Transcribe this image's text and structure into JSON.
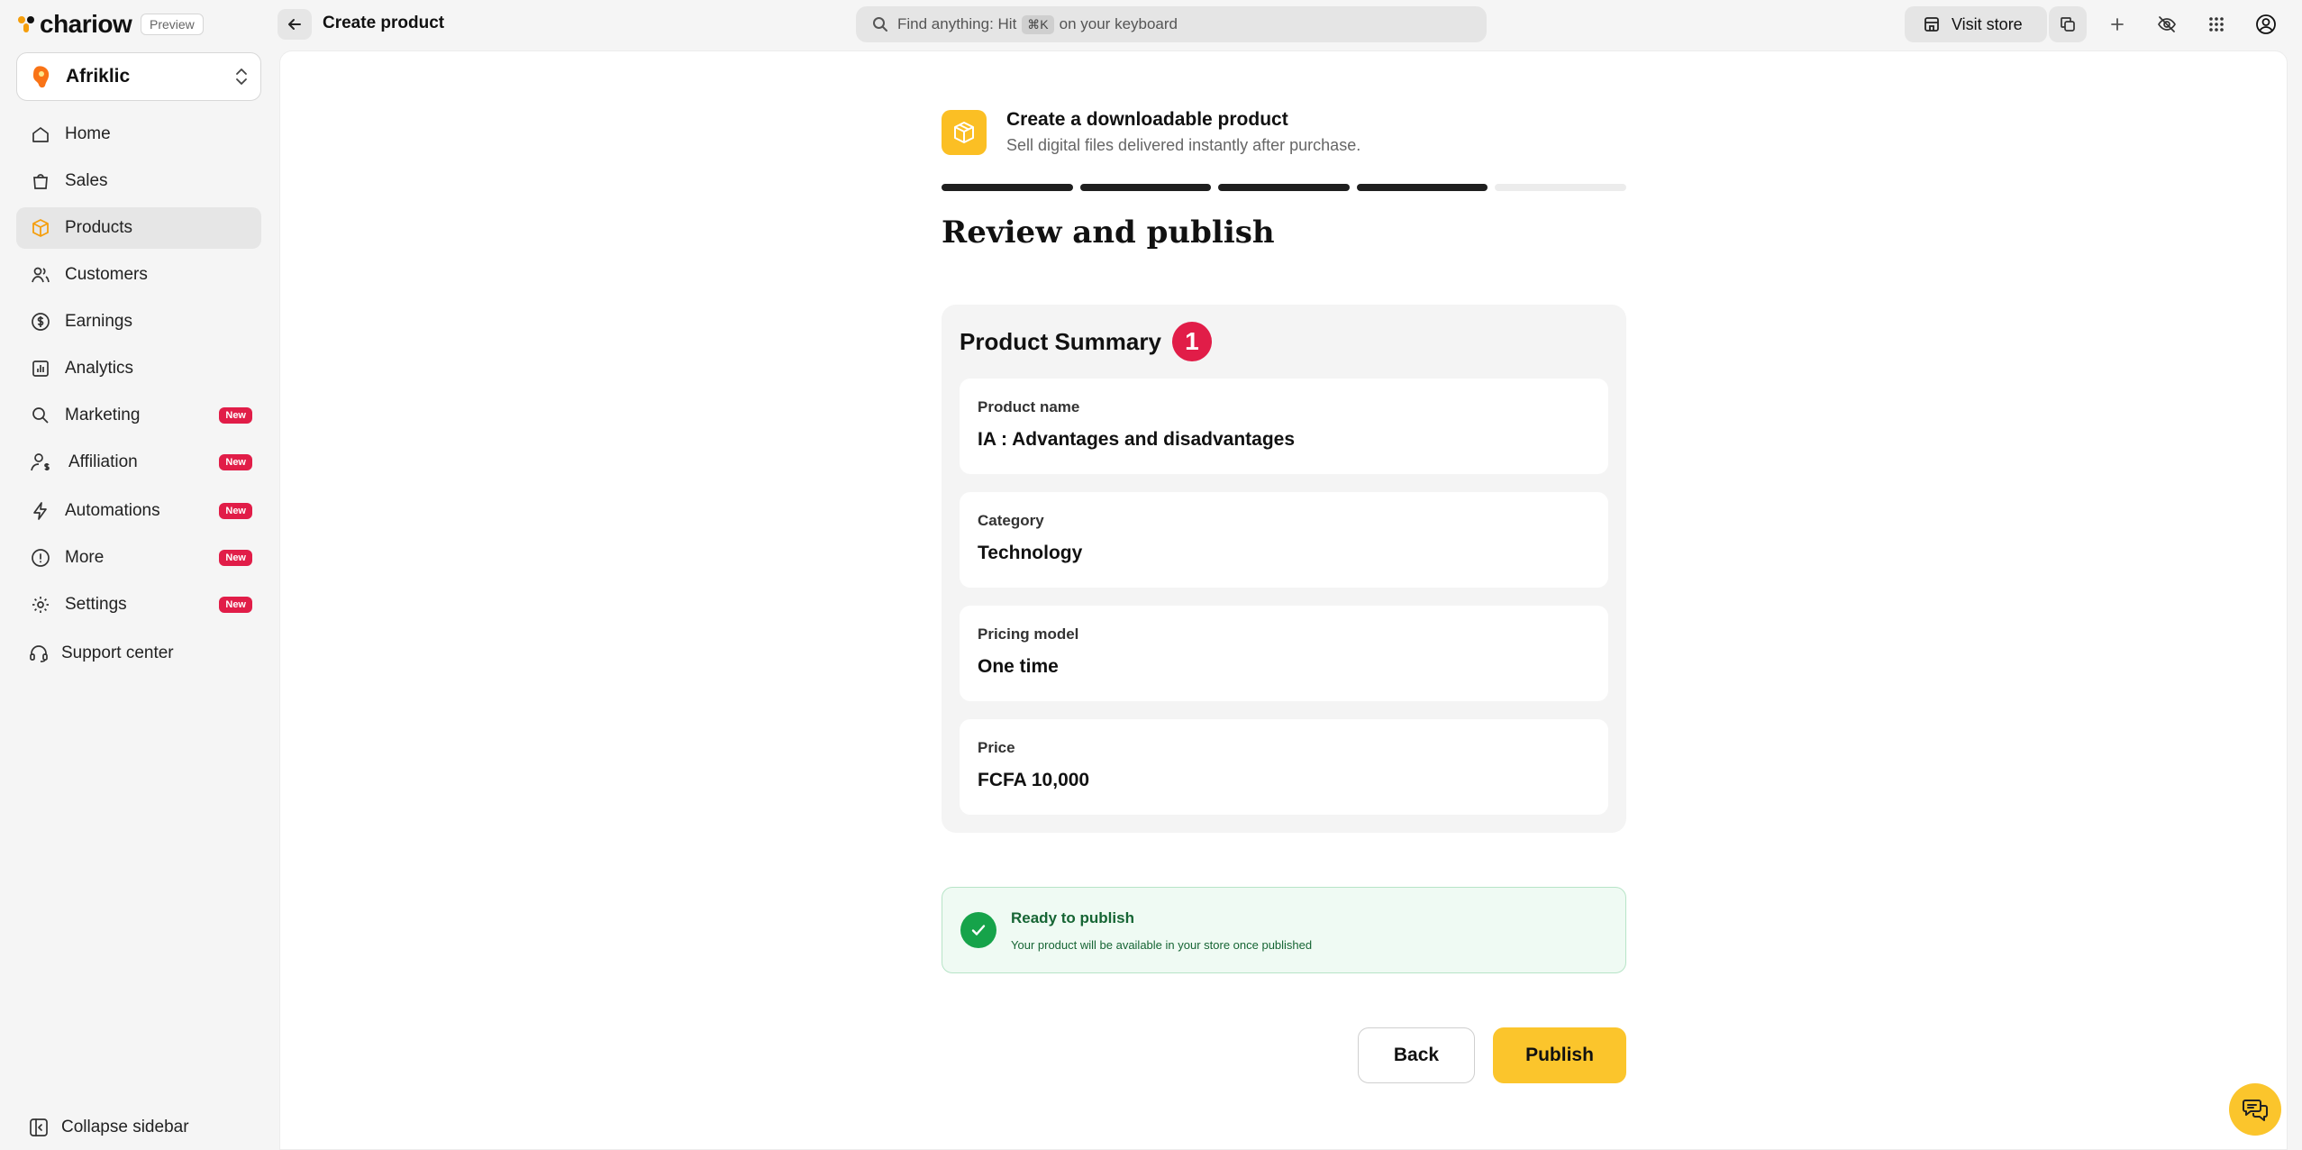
{
  "brand": {
    "name": "chariow",
    "preview_label": "Preview"
  },
  "header": {
    "page_title": "Create product",
    "search": {
      "prefix": "Find anything: Hit",
      "shortcut": "⌘K",
      "suffix": "on your keyboard"
    },
    "visit_store_label": "Visit store"
  },
  "workspace": {
    "name": "Afriklic"
  },
  "sidebar": {
    "items": [
      {
        "label": "Home",
        "icon": "home-icon",
        "badge": ""
      },
      {
        "label": "Sales",
        "icon": "shopping-bag-icon",
        "badge": ""
      },
      {
        "label": "Products",
        "icon": "box-icon",
        "badge": "",
        "active": true
      },
      {
        "label": "Customers",
        "icon": "users-icon",
        "badge": ""
      },
      {
        "label": "Earnings",
        "icon": "dollar-circle-icon",
        "badge": ""
      },
      {
        "label": "Analytics",
        "icon": "bar-chart-icon",
        "badge": ""
      },
      {
        "label": "Marketing",
        "icon": "megaphone-icon",
        "badge": "New"
      },
      {
        "label": "Affiliation",
        "icon": "user-dollar-icon",
        "badge": "New"
      },
      {
        "label": "Automations",
        "icon": "lightning-icon",
        "badge": "New"
      },
      {
        "label": "More",
        "icon": "info-circle-icon",
        "badge": "New"
      },
      {
        "label": "Settings",
        "icon": "gear-icon",
        "badge": "New"
      }
    ],
    "support_label": "Support center",
    "collapse_label": "Collapse sidebar"
  },
  "wizard": {
    "title": "Create a downloadable product",
    "subtitle": "Sell digital files delivered instantly after purchase.",
    "steps_total": 5,
    "steps_completed": 4,
    "heading": "Review and publish"
  },
  "summary": {
    "title": "Product Summary",
    "count": "1",
    "fields": [
      {
        "label": "Product name",
        "value": "IA : Advantages and disadvantages"
      },
      {
        "label": "Category",
        "value": "Technology"
      },
      {
        "label": "Pricing model",
        "value": "One time"
      },
      {
        "label": "Price",
        "value": "FCFA 10,000"
      }
    ]
  },
  "ready": {
    "title": "Ready to publish",
    "subtitle": "Your product will be available in your store once published"
  },
  "actions": {
    "back_label": "Back",
    "publish_label": "Publish"
  },
  "colors": {
    "accent": "#fbc52c",
    "success": "#16a34a",
    "badge": "#e11d48"
  }
}
